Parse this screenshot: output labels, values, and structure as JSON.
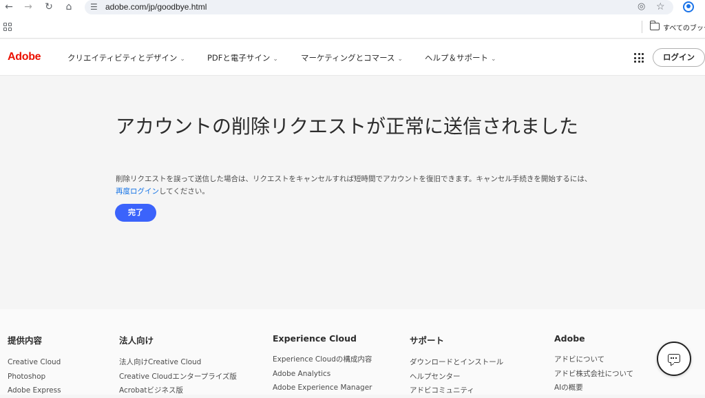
{
  "browser": {
    "url": "adobe.com/jp/goodbye.html",
    "bookmark_label": "すべてのブックマ"
  },
  "header": {
    "logo": "Adobe",
    "nav": [
      {
        "label": "クリエイティビティとデザイン"
      },
      {
        "label": "PDFと電子サイン"
      },
      {
        "label": "マーケティングとコマース"
      },
      {
        "label": "ヘルプ＆サポート"
      }
    ],
    "login_label": "ログイン"
  },
  "main": {
    "headline": "アカウントの削除リクエストが正常に送信されました",
    "body_text": "削除リクエストを誤って送信した場合は、リクエストをキャンセルすれば短時間でアカウントを復旧できます。キャンセル手続きを開始するには、",
    "body_link": "再度ログイン",
    "body_suffix": "してください。",
    "done_label": "完了"
  },
  "footer": {
    "columns": [
      {
        "heading": "提供内容",
        "links": [
          "Creative Cloud",
          "Photoshop",
          "Adobe Express"
        ]
      },
      {
        "heading": "法人向け",
        "links": [
          "法人向けCreative Cloud",
          "Creative Cloudエンタープライズ版",
          "Acrobatビジネス版"
        ]
      },
      {
        "heading": "Experience Cloud",
        "links": [
          "Experience Cloudの構成内容",
          "Adobe Analytics",
          "Adobe Experience Manager"
        ]
      },
      {
        "heading": "サポート",
        "links": [
          "ダウンロードとインストール",
          "ヘルプセンター",
          "アドビコミュニティ"
        ]
      },
      {
        "heading": "Adobe",
        "links": [
          "アドビについて",
          "アドビ株式会社について",
          "AIの概要"
        ]
      }
    ]
  },
  "icons": {
    "back": "arrow-back-icon",
    "forward": "arrow-forward-icon",
    "reload": "reload-icon",
    "home": "home-icon",
    "chat": "chat-icon"
  },
  "colors": {
    "adobe_red": "#eb1000",
    "primary_blue": "#3b63fb",
    "link_blue": "#1473e6"
  }
}
